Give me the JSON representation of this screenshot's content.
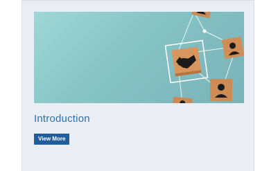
{
  "card": {
    "title": "Introduction",
    "button_label": "View More",
    "image_icon": "handshake-network-icon"
  },
  "colors": {
    "card_background": "#e9eef5",
    "title_text": "#2c6fa6",
    "button_background": "#1f5d9c",
    "button_text": "#ffffff",
    "image_background": "#8ecbcc"
  }
}
